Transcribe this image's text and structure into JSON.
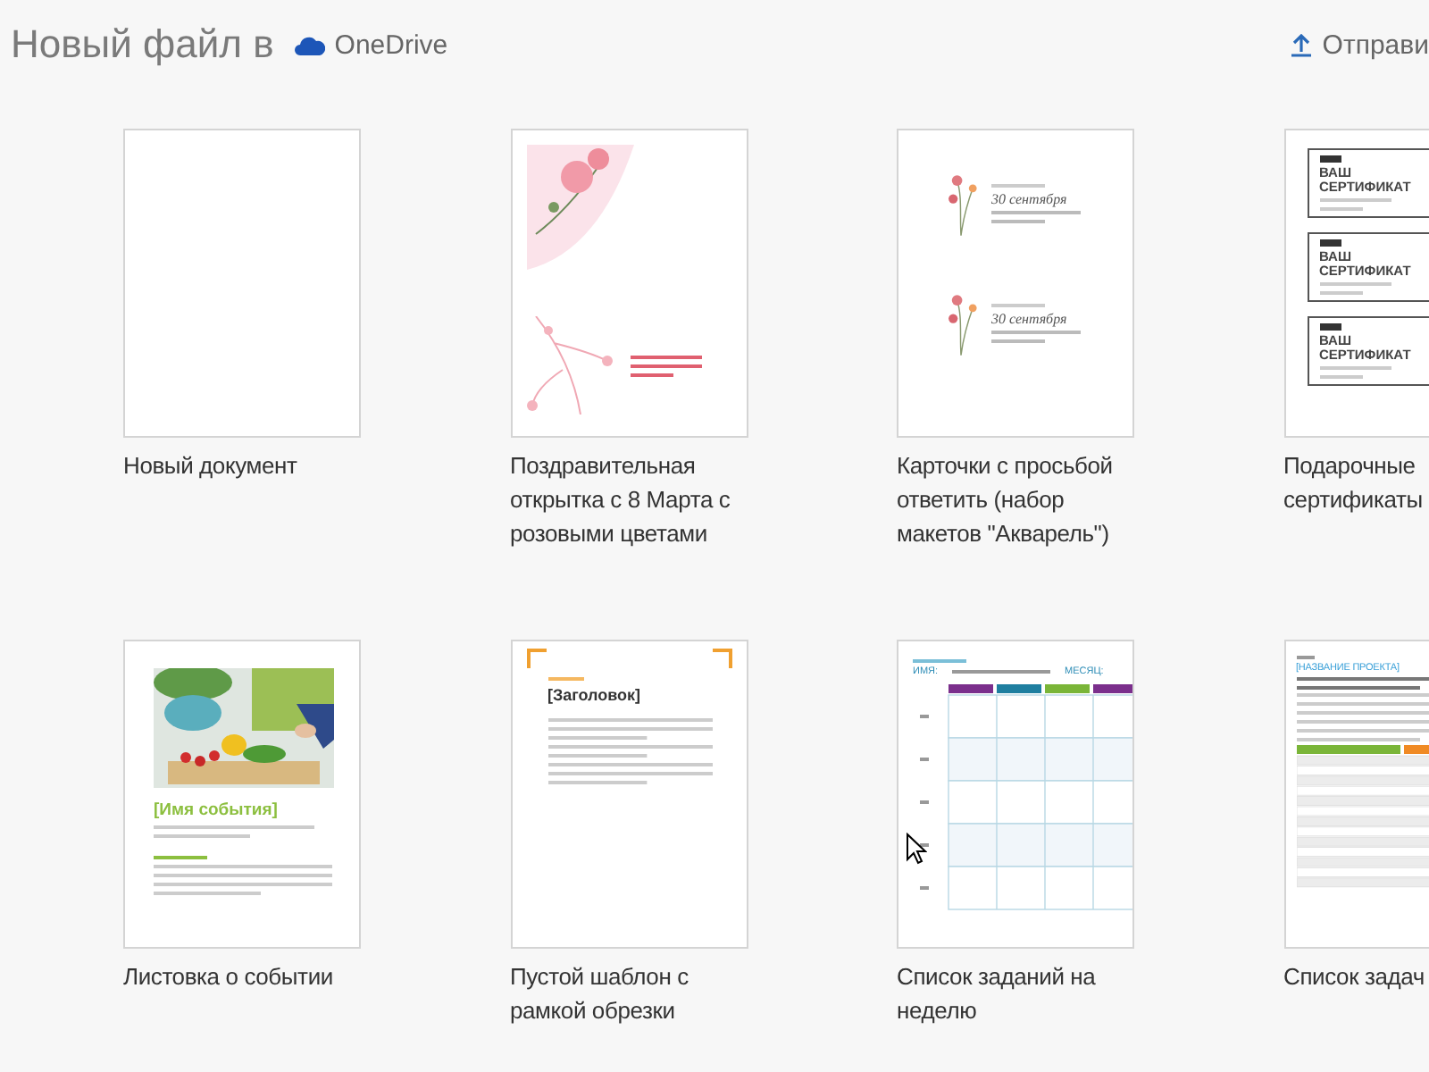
{
  "header": {
    "title": "Новый файл в",
    "location": "OneDrive",
    "upload": "Отправи"
  },
  "templates": [
    {
      "kind": "blank",
      "label": "Новый документ"
    },
    {
      "kind": "card",
      "label": "Поздравительная открытка с 8 Марта с розовыми цветами"
    },
    {
      "kind": "rsvp",
      "label": "Карточки с просьбой ответить (набор макетов \"Акварель\")",
      "dates": [
        "30 сентября",
        "30 сентября"
      ]
    },
    {
      "kind": "certificate",
      "label": "Подарочные сертификаты",
      "headings": [
        "ВАШ СЕРТИФИКАТ",
        "ВАШ СЕРТИФИКАТ",
        "ВАШ СЕРТИФИКАТ"
      ]
    },
    {
      "kind": "flyer",
      "label": "Листовка о событии",
      "heading": "[Имя события]"
    },
    {
      "kind": "cropmarks",
      "label": "Пустой шаблон с рамкой обрезки",
      "heading": "[Заголовок]"
    },
    {
      "kind": "weekly",
      "label": "Список заданий на неделю",
      "name_label": "ИМЯ:",
      "month_label": "МЕСЯЦ:"
    },
    {
      "kind": "tasklist",
      "label": "Список задач",
      "heading": "[НАЗВАНИЕ ПРОЕКТА]"
    }
  ]
}
